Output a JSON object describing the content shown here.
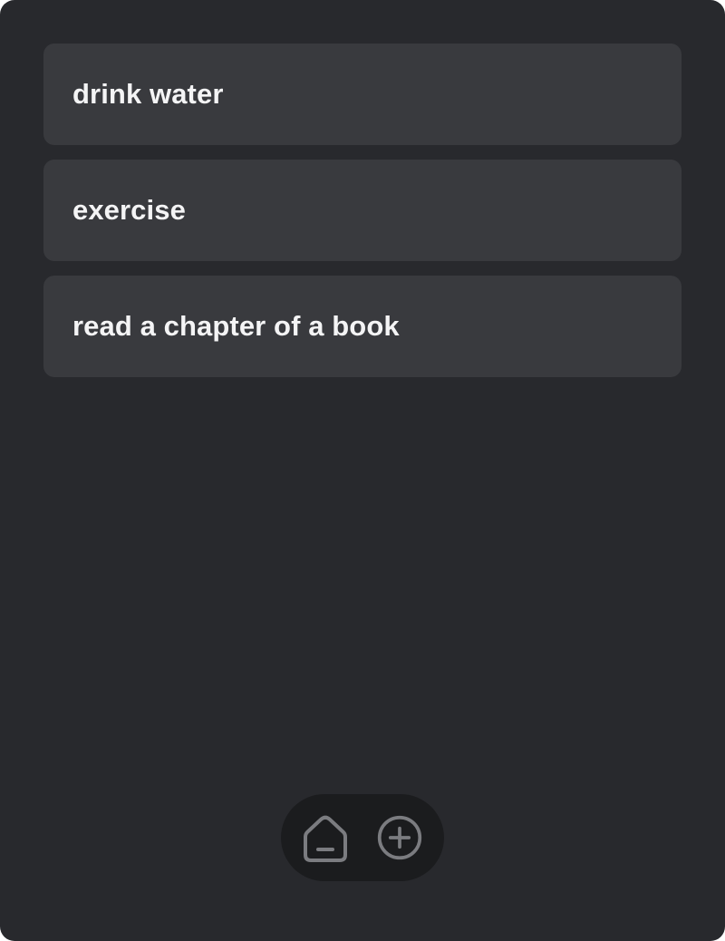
{
  "tasks": [
    {
      "label": "drink water"
    },
    {
      "label": "exercise"
    },
    {
      "label": "read a chapter of a book"
    }
  ],
  "nav": {
    "items": [
      {
        "icon": "home-icon"
      },
      {
        "icon": "plus-circle-icon"
      }
    ]
  },
  "colors": {
    "background": "#28292d",
    "card": "#393a3e",
    "text": "#f4f4f5",
    "nav_background": "#1b1c1e",
    "icon": "#7b7c80"
  }
}
